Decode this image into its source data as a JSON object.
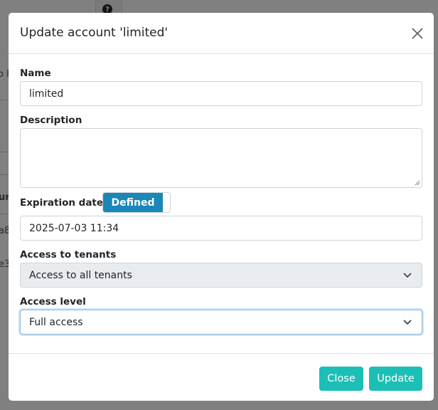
{
  "background": {
    "help_icon_glyph": "?",
    "fragments": [
      "o F",
      "ur",
      "a8",
      "e3"
    ]
  },
  "modal": {
    "title": "Update account 'limited'",
    "close_icon": "close-icon",
    "name": {
      "label": "Name",
      "value": "limited"
    },
    "description": {
      "label": "Description",
      "value": ""
    },
    "expiration": {
      "label": "Expiration date",
      "toggle_label": "Defined",
      "value": "2025-07-03 11:34"
    },
    "tenants": {
      "label": "Access to tenants",
      "selected": "Access to all tenants"
    },
    "access_level": {
      "label": "Access level",
      "selected": "Full access"
    },
    "footer": {
      "close_label": "Close",
      "update_label": "Update"
    }
  },
  "colors": {
    "toggle_active": "#1a87b8",
    "button": "#1bbfb6",
    "overlay": "#808080"
  }
}
